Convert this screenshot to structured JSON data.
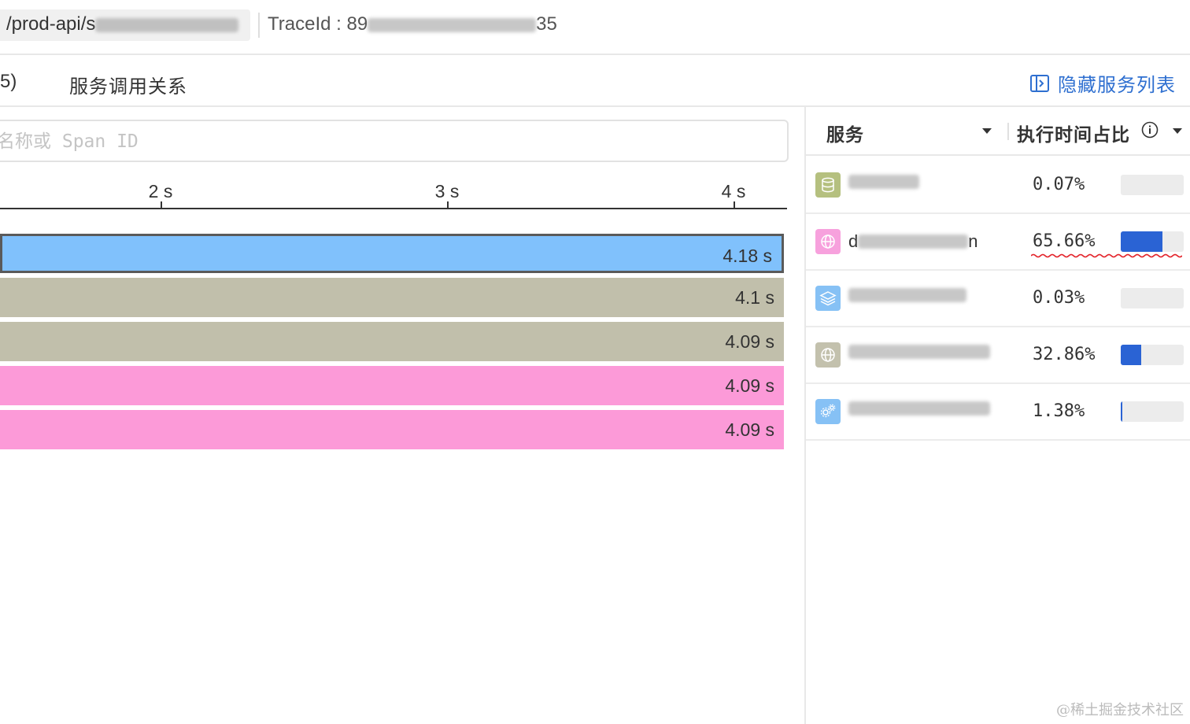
{
  "header": {
    "path_prefix": "/prod-api/s",
    "trace_label": "TraceId : 89",
    "trace_suffix": "35"
  },
  "tabs": {
    "left_fragment": "5)",
    "active": "服务调用关系",
    "hide_services": "隐藏服务列表"
  },
  "search": {
    "placeholder": "名称或 Span ID"
  },
  "timeline": {
    "ticks": [
      {
        "label": "2 s"
      },
      {
        "label": "3 s"
      },
      {
        "label": "4 s"
      }
    ],
    "bars": [
      {
        "duration": "4.18 s",
        "color": "#80c1fc",
        "selected": true
      },
      {
        "duration": "4.1 s",
        "color": "#c1bfab",
        "selected": false
      },
      {
        "duration": "4.09 s",
        "color": "#c1bfab",
        "selected": false
      },
      {
        "duration": "4.09 s",
        "color": "#fc9ad8",
        "selected": false
      },
      {
        "duration": "4.09 s",
        "color": "#fc9ad8",
        "selected": false
      }
    ]
  },
  "service_panel": {
    "col_service": "服务",
    "col_ratio": "执行时间占比",
    "rows": [
      {
        "icon": "database-icon",
        "icon_color": "#b5c07f",
        "name_prefix": "",
        "ratio": "0.07%",
        "fill": 0.0007
      },
      {
        "icon": "globe-icon",
        "icon_color": "#f7a1dd",
        "name_prefix": "d",
        "name_suffix": "n",
        "ratio": "65.66%",
        "fill": 0.6566
      },
      {
        "icon": "layers-icon",
        "icon_color": "#86c1f5",
        "name_prefix": "",
        "ratio": "0.03%",
        "fill": 0.0003
      },
      {
        "icon": "globe-icon",
        "icon_color": "#c3c1ad",
        "name_prefix": "",
        "ratio": "32.86%",
        "fill": 0.3286
      },
      {
        "icon": "gears-icon",
        "icon_color": "#86c1f5",
        "name_prefix": "",
        "ratio": "1.38%",
        "fill": 0.0138
      }
    ]
  },
  "watermark": "@稀土掘金技术社区",
  "colors": {
    "accent": "#2e6fd0",
    "bar_fill": "#2a63d4"
  }
}
